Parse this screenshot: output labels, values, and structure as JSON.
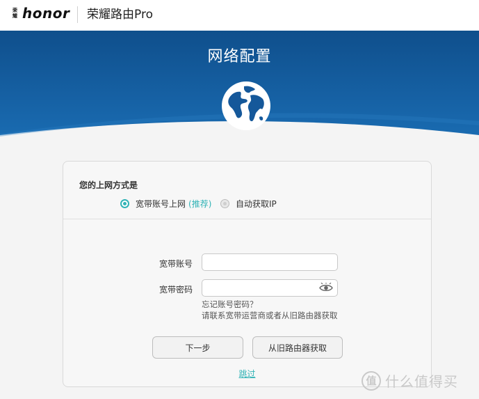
{
  "brand": {
    "logo_cn_top": "荣",
    "logo_cn_bottom": "耀",
    "logo_text": "honor",
    "product_name": "荣耀路由Pro"
  },
  "header": {
    "title": "网络配置",
    "icon": "globe-icon"
  },
  "form": {
    "question": "您的上网方式是",
    "options": [
      {
        "label": "宽带账号上网",
        "note": "(推荐)",
        "selected": true
      },
      {
        "label": "自动获取IP",
        "selected": false
      }
    ],
    "account_label": "宽带账号",
    "account_value": "",
    "password_label": "宽带密码",
    "password_value": "",
    "password_toggle_icon": "eye-icon",
    "hint_line1": "忘记账号密码？",
    "hint_line2": "请联系宽带运营商或者从旧路由器获取",
    "next_button": "下一步",
    "from_old_router_button": "从旧路由器获取",
    "skip_link": "跳过"
  },
  "watermark": {
    "badge": "值",
    "text": "什么值得买"
  },
  "colors": {
    "accent": "#31b3b6",
    "header_blue": "#135a9a",
    "brand_red": "#d0021b"
  }
}
